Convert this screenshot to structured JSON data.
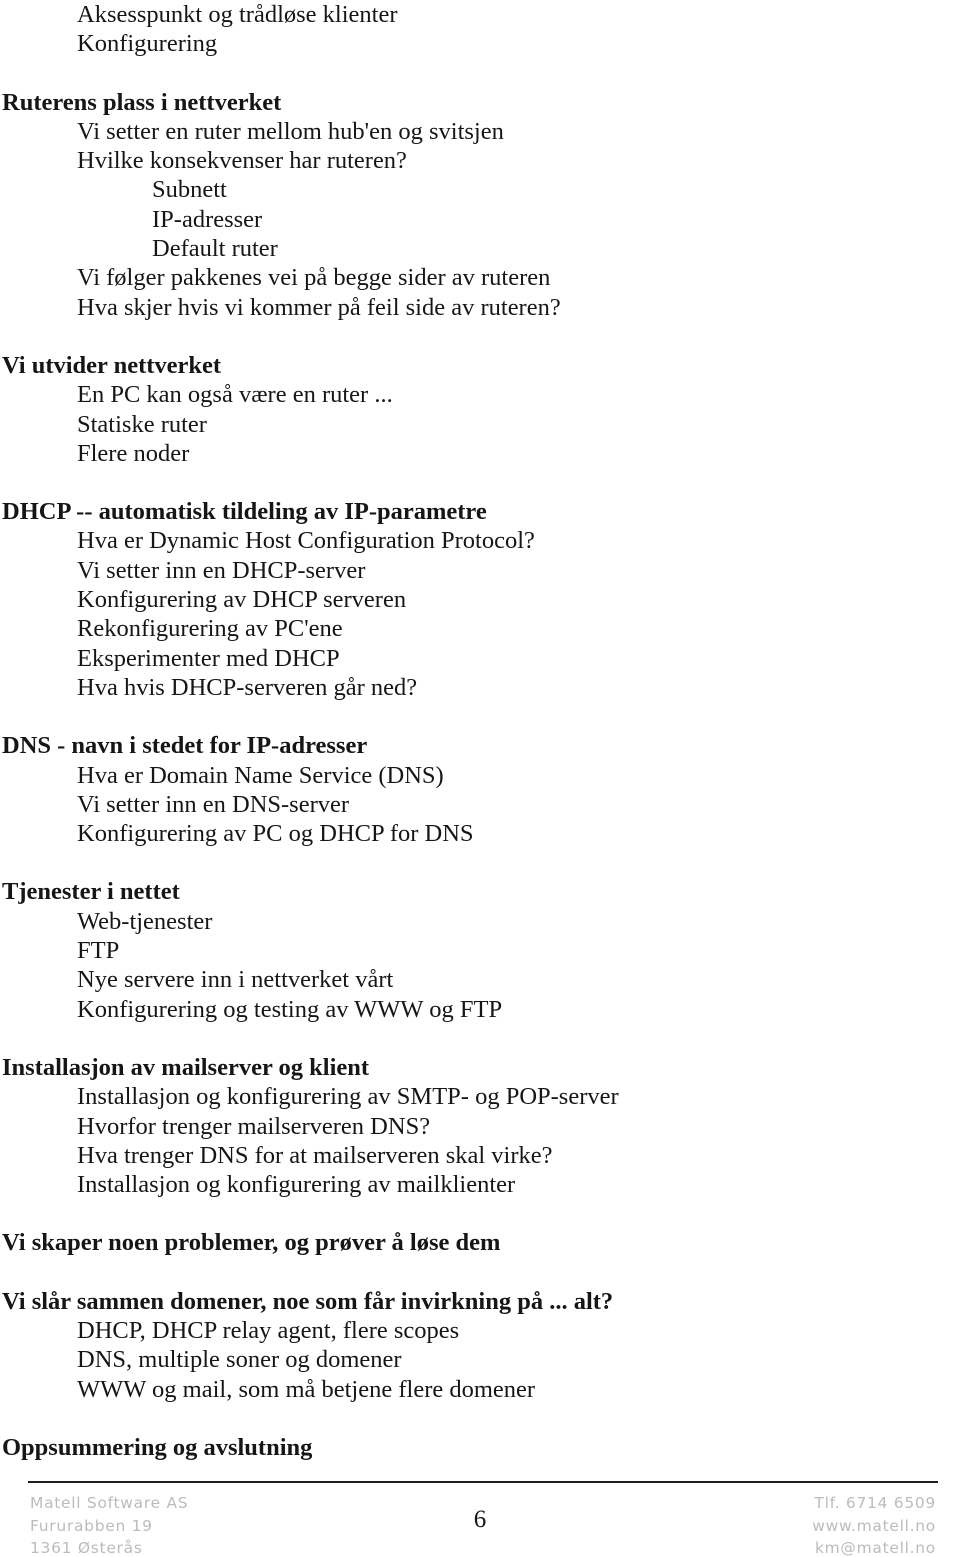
{
  "document": {
    "page_number": "6",
    "blocks": [
      {
        "type": "item",
        "level": 1,
        "text": "Aksesspunkt og trådløse klienter"
      },
      {
        "type": "item",
        "level": 1,
        "text": "Konfigurering"
      },
      {
        "type": "gap"
      },
      {
        "type": "heading",
        "level": 0,
        "text": "Ruterens plass i nettverket"
      },
      {
        "type": "item",
        "level": 1,
        "text": "Vi setter en ruter mellom hub'en og svitsjen"
      },
      {
        "type": "item",
        "level": 1,
        "text": "Hvilke konsekvenser har ruteren?"
      },
      {
        "type": "item",
        "level": 2,
        "text": "Subnett"
      },
      {
        "type": "item",
        "level": 2,
        "text": "IP-adresser"
      },
      {
        "type": "item",
        "level": 2,
        "text": "Default ruter"
      },
      {
        "type": "item",
        "level": 1,
        "text": "Vi følger pakkenes vei på begge sider av ruteren"
      },
      {
        "type": "item",
        "level": 1,
        "text": "Hva skjer hvis vi kommer på feil side av ruteren?"
      },
      {
        "type": "gap"
      },
      {
        "type": "heading",
        "level": 0,
        "text": "Vi utvider nettverket"
      },
      {
        "type": "item",
        "level": 1,
        "text": "En PC kan også være en ruter ..."
      },
      {
        "type": "item",
        "level": 1,
        "text": "Statiske ruter"
      },
      {
        "type": "item",
        "level": 1,
        "text": "Flere noder"
      },
      {
        "type": "gap"
      },
      {
        "type": "heading",
        "level": 0,
        "text": "DHCP -- automatisk tildeling av IP-parametre"
      },
      {
        "type": "item",
        "level": 1,
        "text": "Hva er Dynamic Host Configuration Protocol?"
      },
      {
        "type": "item",
        "level": 1,
        "text": "Vi setter inn en DHCP-server"
      },
      {
        "type": "item",
        "level": 1,
        "text": "Konfigurering av DHCP serveren"
      },
      {
        "type": "item",
        "level": 1,
        "text": "Rekonfigurering av PC'ene"
      },
      {
        "type": "item",
        "level": 1,
        "text": "Eksperimenter med DHCP"
      },
      {
        "type": "item",
        "level": 1,
        "text": "Hva hvis DHCP-serveren går ned?"
      },
      {
        "type": "gap"
      },
      {
        "type": "heading",
        "level": 0,
        "text": "DNS - navn i stedet for IP-adresser"
      },
      {
        "type": "item",
        "level": 1,
        "text": "Hva er Domain Name Service (DNS)"
      },
      {
        "type": "item",
        "level": 1,
        "text": "Vi setter inn en DNS-server"
      },
      {
        "type": "item",
        "level": 1,
        "text": "Konfigurering av PC og DHCP for DNS"
      },
      {
        "type": "gap"
      },
      {
        "type": "heading",
        "level": 0,
        "text": "Tjenester i nettet"
      },
      {
        "type": "item",
        "level": 1,
        "text": "Web-tjenester"
      },
      {
        "type": "item",
        "level": 1,
        "text": "FTP"
      },
      {
        "type": "item",
        "level": 1,
        "text": "Nye servere inn i nettverket vårt"
      },
      {
        "type": "item",
        "level": 1,
        "text": "Konfigurering og testing av WWW og FTP"
      },
      {
        "type": "gap"
      },
      {
        "type": "heading",
        "level": 0,
        "text": "Installasjon av mailserver og klient"
      },
      {
        "type": "item",
        "level": 1,
        "text": "Installasjon og konfigurering av SMTP- og POP-server"
      },
      {
        "type": "item",
        "level": 1,
        "text": "Hvorfor trenger mailserveren DNS?"
      },
      {
        "type": "item",
        "level": 1,
        "text": "Hva trenger DNS for at mailserveren skal virke?"
      },
      {
        "type": "item",
        "level": 1,
        "text": "Installasjon og konfigurering av mailklienter"
      },
      {
        "type": "gap"
      },
      {
        "type": "heading",
        "level": 0,
        "text": "Vi skaper noen problemer, og prøver å løse dem"
      },
      {
        "type": "gap"
      },
      {
        "type": "heading",
        "level": 0,
        "text": "Vi slår sammen domener, noe som får invirkning på ... alt?"
      },
      {
        "type": "item",
        "level": 1,
        "text": "DHCP, DHCP relay agent, flere scopes"
      },
      {
        "type": "item",
        "level": 1,
        "text": "DNS, multiple soner og domener"
      },
      {
        "type": "item",
        "level": 1,
        "text": "WWW og mail, som må betjene flere domener"
      },
      {
        "type": "gap"
      },
      {
        "type": "heading",
        "level": 0,
        "text": "Oppsummering og avslutning"
      }
    ]
  },
  "footer": {
    "left_lines": [
      "Matell Software AS",
      "Fururabben 19",
      "1361 Østerås"
    ],
    "right_lines": [
      "Tlf. 6714 6509",
      "www.matell.no",
      "km@matell.no"
    ]
  }
}
